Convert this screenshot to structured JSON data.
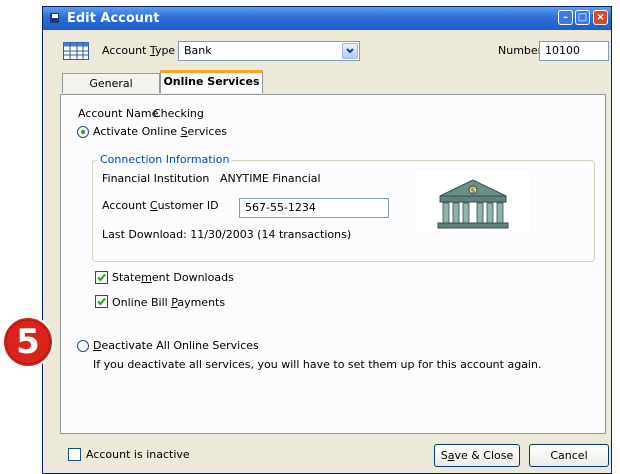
{
  "window": {
    "title": "Edit Account"
  },
  "toprow": {
    "account_type_label_pre": "Account ",
    "account_type_label_u": "T",
    "account_type_label_post": "ype",
    "account_type_value": "Bank",
    "number_label": "Number",
    "number_value": "10100"
  },
  "tabs": [
    {
      "label": "General"
    },
    {
      "label": "Online Services"
    }
  ],
  "panel": {
    "account_name_label": "Account Name",
    "account_name_value": "Checking",
    "activate_label_pre": "Activate Online ",
    "activate_label_u": "S",
    "activate_label_post": "ervices",
    "connection": {
      "legend": "Connection Information",
      "fi_label": "Financial Institution",
      "fi_value": "ANYTIME Financial",
      "customer_id_label_pre": "Account ",
      "customer_id_label_u": "C",
      "customer_id_label_post": "ustomer ID",
      "customer_id_value": "567-55-1234",
      "last_download": "Last Download: 11/30/2003 (14 transactions)"
    },
    "statement_label_pre": "State",
    "statement_label_u": "m",
    "statement_label_post": "ent Downloads",
    "billpay_label_pre": "Online Bill ",
    "billpay_label_u": "P",
    "billpay_label_post": "ayments",
    "deactivate_label_pre": "",
    "deactivate_label_u": "D",
    "deactivate_label_post": "eactivate All Online Services",
    "deactivate_note": "If you deactivate all services, you will have to set them up for this account again."
  },
  "footer": {
    "inactive_label": "Account is inactive",
    "save_pre": "S",
    "save_u": "a",
    "save_post": "ve & Close",
    "cancel": "Cancel"
  },
  "callout": {
    "number": "5",
    "color": "#d9241c"
  },
  "colors": {
    "tab_accent": "#f5a623",
    "legend_blue": "#0046d5",
    "title_blue": "#2a6ed8"
  }
}
